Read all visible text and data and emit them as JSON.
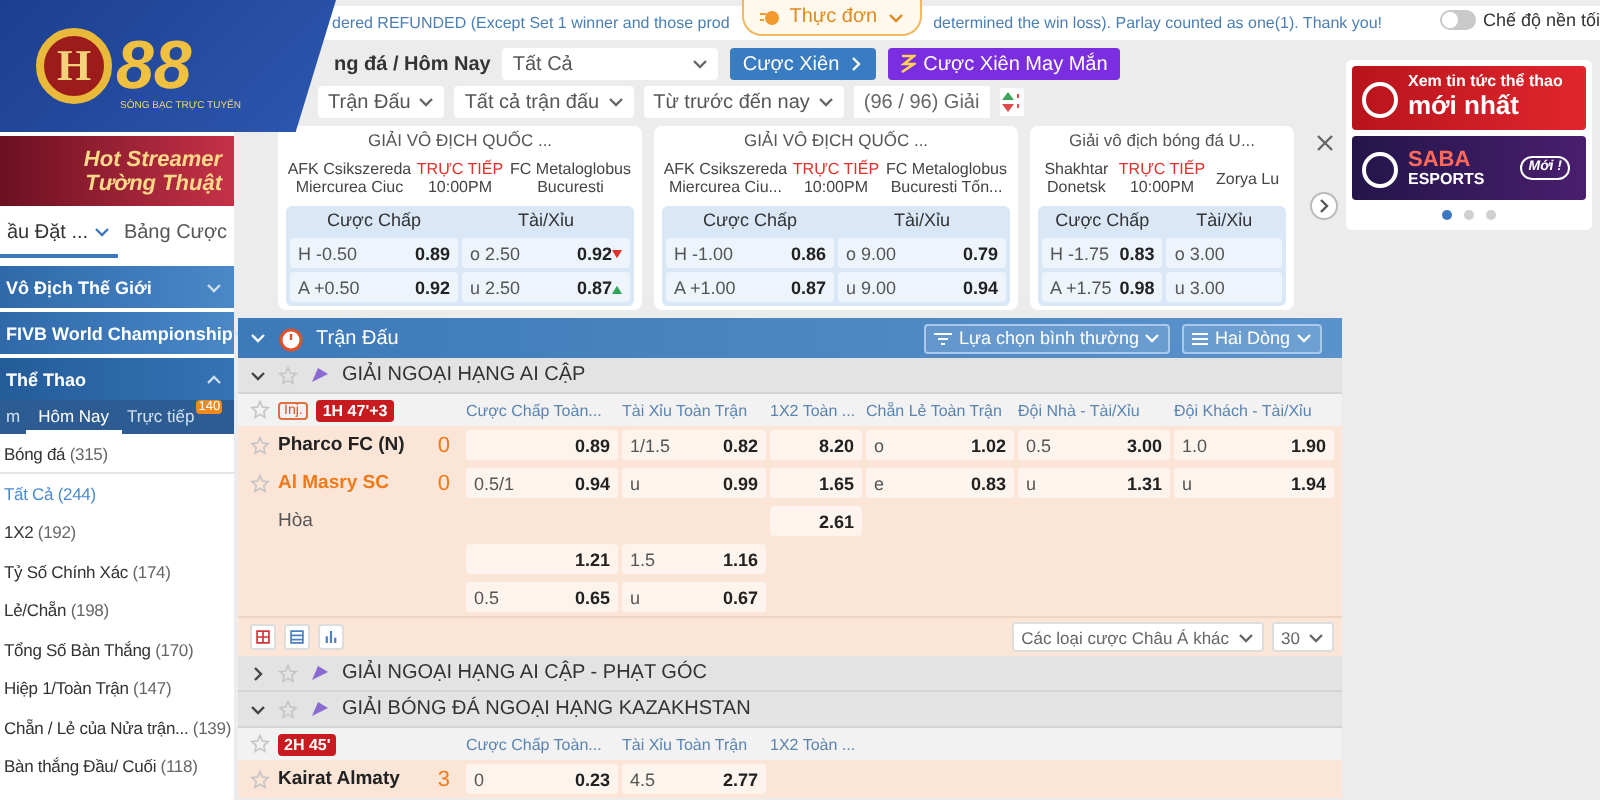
{
  "logo": {
    "mark": "H",
    "number": "88",
    "tagline": "SÒNG BẠC TRỰC TUYẾN"
  },
  "notice": {
    "text_before": "dered REFUNDED (Except Set 1 winner and those prod",
    "text_after": "determined the win loss). Parlay counted as one(1). Thank you!"
  },
  "menu_tab": {
    "label": "Thực đơn"
  },
  "dark_mode": {
    "label": "Chế độ nền tối",
    "on": false
  },
  "sidebar": {
    "banner": {
      "line1": "Hot Streamer",
      "line2": "Tường Thuật"
    },
    "tabs": [
      {
        "label": "ầu Đặt ...",
        "selected": true
      },
      {
        "label": "Bảng Cược",
        "selected": false
      }
    ],
    "sections": [
      {
        "label": "Vô Địch Thế Giới",
        "expanded": false
      },
      {
        "label": "FIVB World Championship",
        "expanded": false
      },
      {
        "label": "Thể Thao",
        "expanded": true
      }
    ],
    "period_tabs": [
      {
        "label": "m",
        "selected": false
      },
      {
        "label": "Hôm Nay",
        "selected": true
      },
      {
        "label": "Trực tiếp",
        "selected": false,
        "badge": "140"
      }
    ],
    "sports": [
      {
        "label": "Bóng đá",
        "count": "(315)",
        "children": [
          {
            "label": "Tất Cả",
            "count": "(244)",
            "selected": true
          },
          {
            "label": "1X2",
            "count": "(192)",
            "selected": false
          },
          {
            "label": "Tỷ Số Chính Xác",
            "count": "(174)",
            "selected": false
          },
          {
            "label": "Lẻ/Chẵn",
            "count": "(198)",
            "selected": false
          },
          {
            "label": "Tổng Số Bàn Thắng",
            "count": "(170)",
            "selected": false
          },
          {
            "label": "Hiệp 1/Toàn Trận",
            "count": "(147)",
            "selected": false
          },
          {
            "label": "Chẵn / Lẻ của Nửa trận...",
            "count": "(139)",
            "selected": false
          },
          {
            "label": "Bàn thắng Đầu/ Cuối",
            "count": "(118)",
            "selected": false
          }
        ]
      }
    ]
  },
  "filters": {
    "breadcrumb": "ng đá / Hôm Nay",
    "market_select": "Tất Cả",
    "parlay_button": "Cược Xiên",
    "lucky_button": "Cược Xiên May Mắn",
    "dropdowns": [
      "Trận Đấu",
      "Tất cả trận đấu",
      "Từ trước đến nay"
    ],
    "league_count": "(96 / 96) Giải"
  },
  "featured": [
    {
      "league": "GIẢI VÔ ĐỊCH QUỐC ...",
      "home": "AFK Csikszereda Miercurea Ciuc",
      "status": "TRỰC TIẾP",
      "time": "10:00PM",
      "away": "FC Metaloglobus Bucuresti",
      "handicap_label": "Cược Chấp",
      "total_label": "Tài/Xỉu",
      "lines": [
        {
          "hdp_side": "H",
          "hdp": "-0.50",
          "hdp_odds": "0.89",
          "ou_side": "o",
          "ou": "2.50",
          "ou_odds": "0.92",
          "rising": false
        },
        {
          "hdp_side": "A",
          "hdp": "+0.50",
          "hdp_odds": "0.92",
          "ou_side": "u",
          "ou": "2.50",
          "ou_odds": "0.87",
          "rising": true
        }
      ]
    },
    {
      "league": "GIẢI VÔ ĐỊCH QUỐC ...",
      "home": "AFK Csikszereda Miercurea Ciu...",
      "status": "TRỰC TIẾP",
      "time": "10:00PM",
      "away": "FC Metaloglobus Bucuresti Tốn...",
      "handicap_label": "Cược Chấp",
      "total_label": "Tài/Xỉu",
      "lines": [
        {
          "hdp_side": "H",
          "hdp": "-1.00",
          "hdp_odds": "0.86",
          "ou_side": "o",
          "ou": "9.00",
          "ou_odds": "0.79"
        },
        {
          "hdp_side": "A",
          "hdp": "+1.00",
          "hdp_odds": "0.87",
          "ou_side": "u",
          "ou": "9.00",
          "ou_odds": "0.94"
        }
      ]
    },
    {
      "league": "Giải vô địch bóng đá U...",
      "home": "Shakhtar Donetsk",
      "status": "TRỰC TIẾP",
      "time": "10:00PM",
      "away": "Zorya Lu",
      "handicap_label": "Cược Chấp",
      "total_label": "Tài/Xỉu",
      "lines": [
        {
          "hdp_side": "H",
          "hdp": "-1.75",
          "hdp_odds": "0.83",
          "ou_side": "o",
          "ou": "3.00"
        },
        {
          "hdp_side": "A",
          "hdp": "+1.75",
          "hdp_odds": "0.98",
          "ou_side": "u",
          "ou": "3.00"
        }
      ]
    }
  ],
  "ads": {
    "banners": [
      {
        "kind": "news",
        "line1": "Xem tin tức thể thao",
        "line2": "mới nhất"
      },
      {
        "kind": "esports",
        "line1": "SABA",
        "line2": "ESPORTS",
        "badge": "Mới !"
      }
    ],
    "dots": [
      {
        "selected": true
      },
      {
        "selected": false
      },
      {
        "selected": false
      }
    ]
  },
  "matches": {
    "title": "Trận Đấu",
    "view_button": "Lựa chọn bình thường",
    "lines_button": "Hai Dòng",
    "leagues": [
      {
        "name": "GIẢI NGOẠI HẠNG AI CẬP",
        "expanded": true,
        "injury": "Inj.",
        "time": "1H 47'+3",
        "columns": [
          "Cược Chấp Toàn...",
          "Tài Xỉu Toàn Trận",
          "1X2 Toàn ...",
          "Chẵn Lẻ Toàn Trận",
          "Đội Nhà - Tài/Xỉu",
          "Đội Khách - Tài/Xỉu"
        ],
        "rows": [
          {
            "kind": "team",
            "team": "Pharco FC (N)",
            "score": "0",
            "highlighted": false,
            "odds": [
              {
                "odds": "0.89"
              },
              {
                "line": "1/1.5",
                "odds": "0.82"
              },
              {
                "odds": "8.20"
              },
              {
                "line": "o",
                "odds": "1.02"
              },
              {
                "line": "0.5",
                "odds": "3.00"
              },
              {
                "line": "1.0",
                "odds": "1.90"
              }
            ]
          },
          {
            "kind": "team",
            "team": "Al Masry SC",
            "score": "0",
            "highlighted": true,
            "odds": [
              {
                "line": "0.5/1",
                "odds": "0.94"
              },
              {
                "line": "u",
                "odds": "0.99"
              },
              {
                "odds": "1.65"
              },
              {
                "line": "e",
                "odds": "0.83"
              },
              {
                "line": "u",
                "odds": "1.31"
              },
              {
                "line": "u",
                "odds": "1.94"
              }
            ]
          },
          {
            "kind": "draw",
            "team": "Hòa",
            "odds": [
              {
                "odds": "2.61"
              }
            ]
          },
          {
            "kind": "line",
            "odds": [
              {
                "odds": "1.21"
              },
              {
                "line": "1.5",
                "odds": "1.16"
              }
            ]
          },
          {
            "kind": "line",
            "odds": [
              {
                "line": "0.5",
                "odds": "0.65"
              },
              {
                "line": "u",
                "odds": "0.67"
              }
            ]
          }
        ],
        "toolbar": {
          "market_select": "Các loại cược Châu Á khác",
          "page_size": "30"
        }
      },
      {
        "name": "GIẢI NGOẠI HẠNG AI CẬP - PHẠT GÓC",
        "expanded": false
      },
      {
        "name": "GIẢI BÓNG ĐÁ NGOẠI HẠNG KAZAKHSTAN",
        "expanded": true,
        "time": "2H 45'",
        "columns": [
          "Cược Chấp Toàn...",
          "Tài Xỉu Toàn Trận",
          "1X2 Toàn ..."
        ],
        "rows": [
          {
            "kind": "team",
            "team": "Kairat Almaty",
            "score": "3",
            "highlighted": false,
            "odds": [
              {
                "line": "0",
                "odds": "0.23"
              },
              {
                "line": "4.5",
                "odds": "2.77"
              }
            ]
          }
        ]
      }
    ]
  }
}
